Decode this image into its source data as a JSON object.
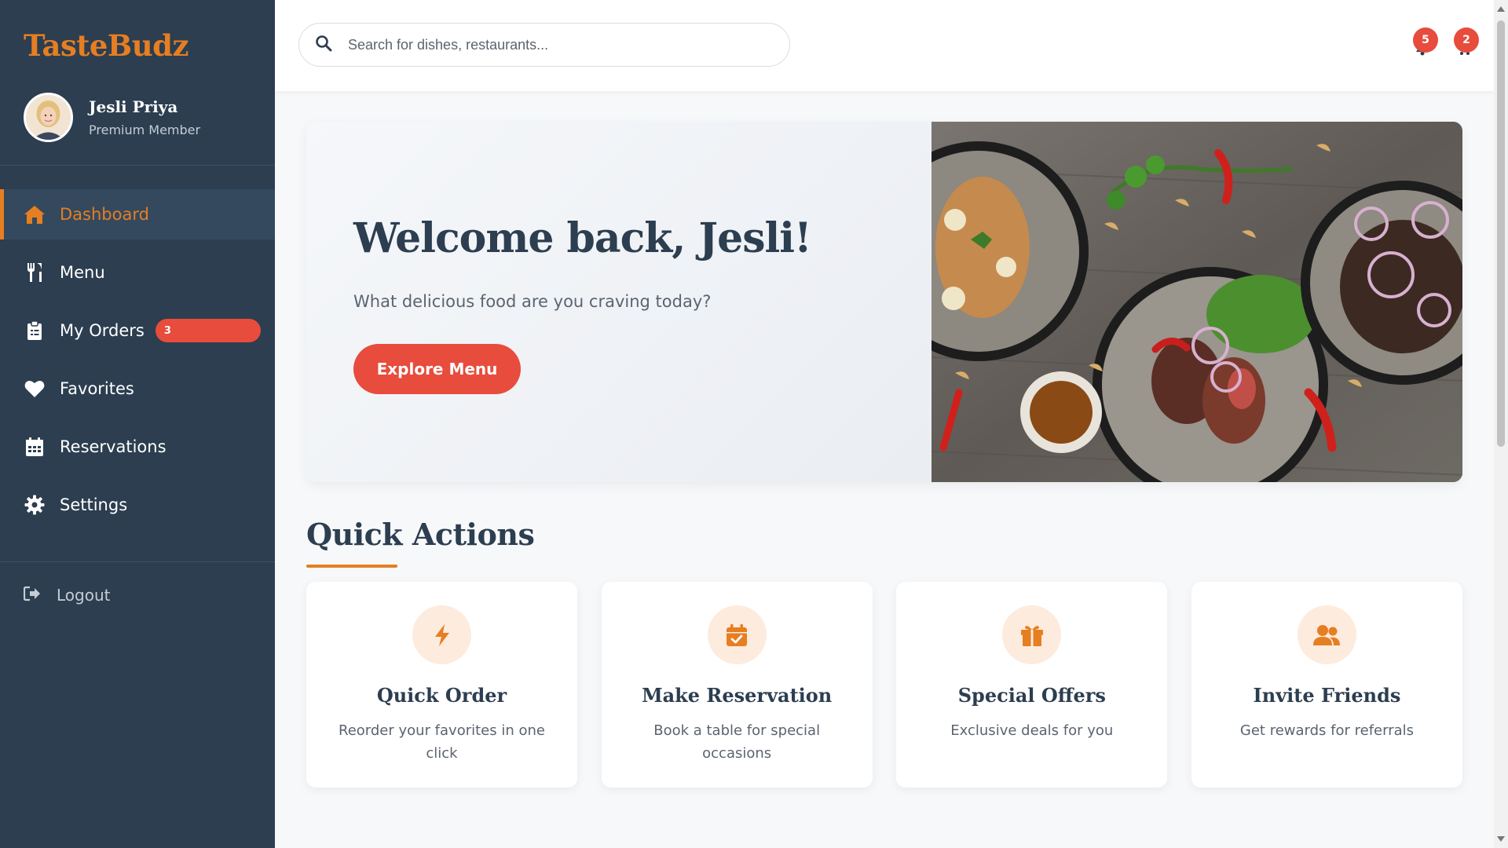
{
  "app": {
    "brand": "TasteBudz"
  },
  "profile": {
    "name": "Jesli Priya",
    "role": "Premium Member"
  },
  "nav": {
    "items": [
      {
        "label": "Dashboard",
        "icon": "home-icon"
      },
      {
        "label": "Menu",
        "icon": "utensils-icon"
      },
      {
        "label": "My Orders",
        "icon": "clipboard-icon",
        "badge": "3"
      },
      {
        "label": "Favorites",
        "icon": "heart-icon"
      },
      {
        "label": "Reservations",
        "icon": "calendar-icon"
      },
      {
        "label": "Settings",
        "icon": "gear-icon"
      }
    ],
    "logout": "Logout"
  },
  "search": {
    "placeholder": "Search for dishes, restaurants..."
  },
  "topbar": {
    "notifications_count": "5",
    "cart_count": "2"
  },
  "hero": {
    "title": "Welcome back, Jesli!",
    "subtitle": "What delicious food are you craving today?",
    "button": "Explore Menu"
  },
  "quick_actions": {
    "title": "Quick Actions",
    "cards": [
      {
        "title": "Quick Order",
        "desc": "Reorder your favorites in one click",
        "icon": "bolt-icon"
      },
      {
        "title": "Make Reservation",
        "desc": "Book a table for special occasions",
        "icon": "calendar-check-icon"
      },
      {
        "title": "Special Offers",
        "desc": "Exclusive deals for you",
        "icon": "gift-icon"
      },
      {
        "title": "Invite Friends",
        "desc": "Get rewards for referrals",
        "icon": "users-icon"
      }
    ]
  },
  "colors": {
    "sidebar": "#2c3e50",
    "accent": "#e67e22",
    "primary": "#e74c3c"
  }
}
